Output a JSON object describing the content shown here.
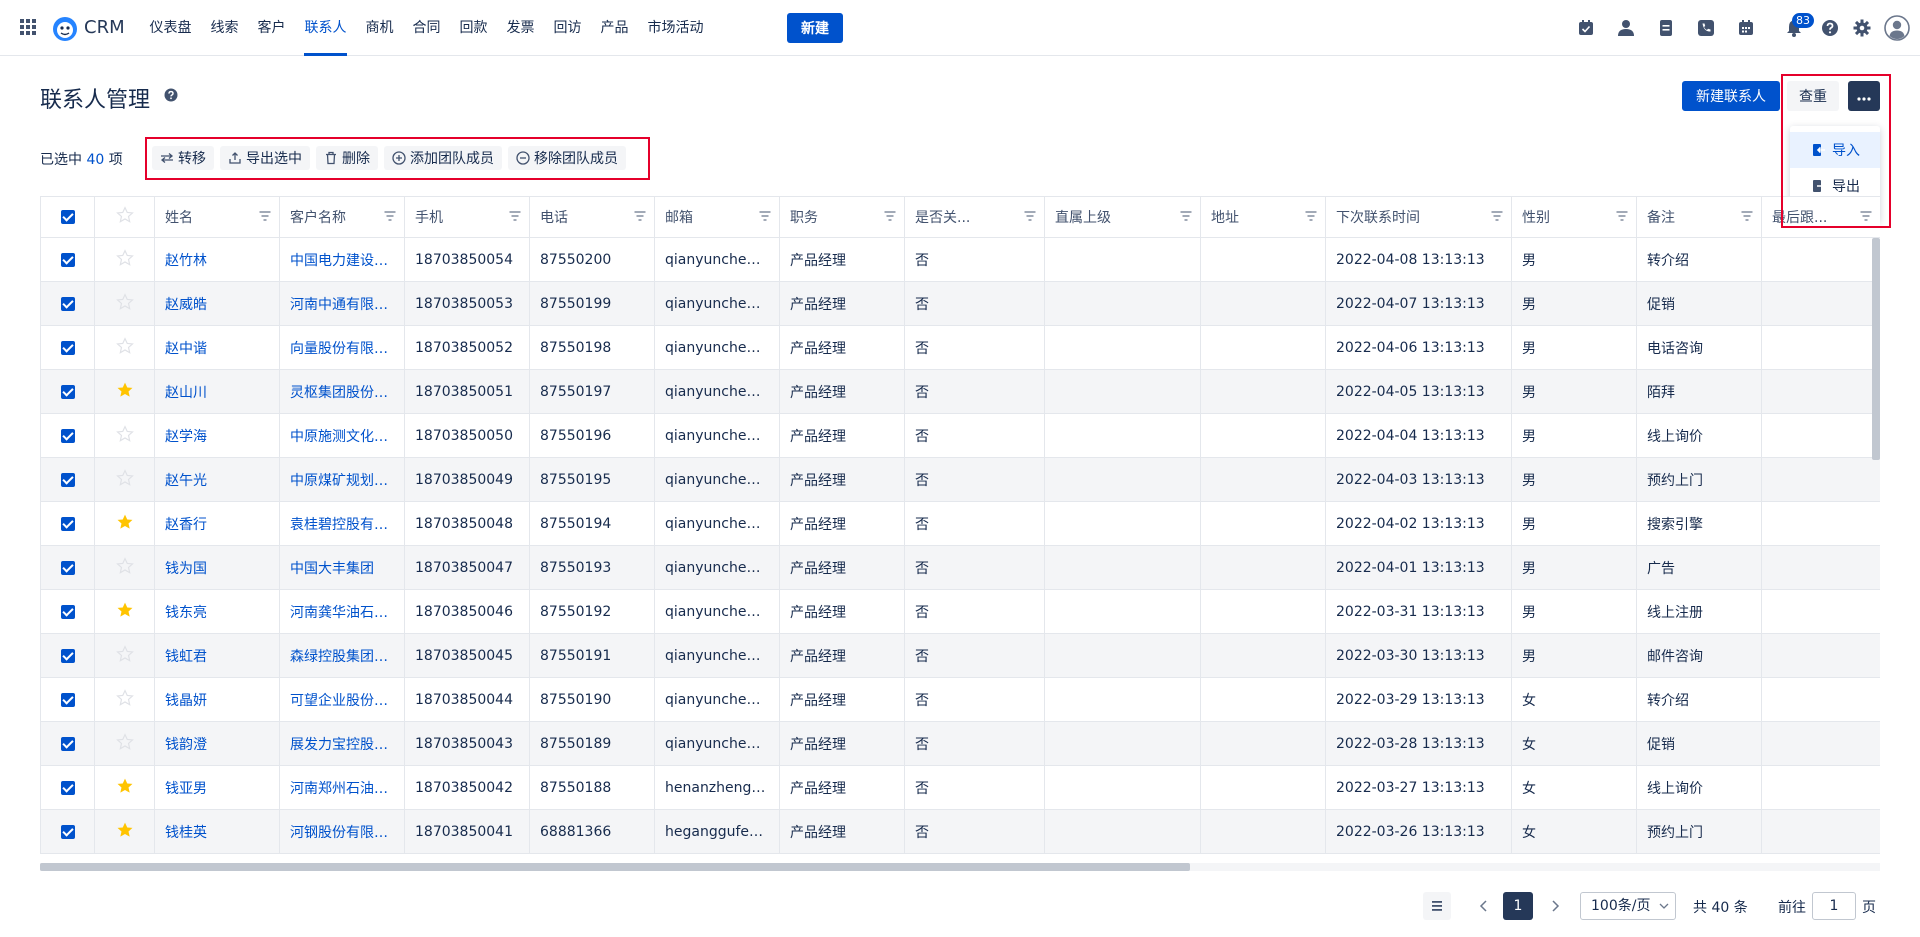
{
  "app": {
    "brand": "CRM"
  },
  "nav": {
    "items": [
      "仪表盘",
      "线索",
      "客户",
      "联系人",
      "商机",
      "合同",
      "回款",
      "发票",
      "回访",
      "产品",
      "市场活动"
    ],
    "active_index": 3,
    "new_label": "新建",
    "notification_count": "83"
  },
  "header": {
    "title": "联系人管理",
    "new_contact": "新建联系人",
    "reset": "查重",
    "more_menu": {
      "import": "导入",
      "export": "导出"
    }
  },
  "selection": {
    "prefix": "已选中",
    "count": "40",
    "suffix": "项"
  },
  "actions": {
    "transfer": "转移",
    "export_selected": "导出选中",
    "delete": "删除",
    "add_team_member": "添加团队成员",
    "remove_team_member": "移除团队成员"
  },
  "table": {
    "columns": [
      "姓名",
      "客户名称",
      "手机",
      "电话",
      "邮箱",
      "职务",
      "是否关...",
      "直属上级",
      "地址",
      "下次联系时间",
      "性别",
      "备注",
      "最后跟..."
    ],
    "rows": [
      {
        "starred": false,
        "name": "赵竹林",
        "customer": "中国电力建设股份...",
        "mobile": "18703850054",
        "phone": "87550200",
        "email": "qianyuncheng...",
        "title": "产品经理",
        "is_key": "否",
        "superior": "",
        "address": "",
        "next_contact": "2022-04-08 13:13:13",
        "gender": "男",
        "note": "转介绍"
      },
      {
        "starred": false,
        "name": "赵威皓",
        "customer": "河南中通有限公司",
        "mobile": "18703850053",
        "phone": "87550199",
        "email": "qianyuncheng...",
        "title": "产品经理",
        "is_key": "否",
        "superior": "",
        "address": "",
        "next_contact": "2022-04-07 13:13:13",
        "gender": "男",
        "note": "促销"
      },
      {
        "starred": false,
        "name": "赵中谐",
        "customer": "向量股份有限公司",
        "mobile": "18703850052",
        "phone": "87550198",
        "email": "qianyuncheng...",
        "title": "产品经理",
        "is_key": "否",
        "superior": "",
        "address": "",
        "next_contact": "2022-04-06 13:13:13",
        "gender": "男",
        "note": "电话咨询"
      },
      {
        "starred": true,
        "name": "赵山川",
        "customer": "灵枢集团股份有限...",
        "mobile": "18703850051",
        "phone": "87550197",
        "email": "qianyuncheng...",
        "title": "产品经理",
        "is_key": "否",
        "superior": "",
        "address": "",
        "next_contact": "2022-04-05 13:13:13",
        "gender": "男",
        "note": "陌拜"
      },
      {
        "starred": false,
        "name": "赵学海",
        "customer": "中原施测文化传媒...",
        "mobile": "18703850050",
        "phone": "87550196",
        "email": "qianyuncheng...",
        "title": "产品经理",
        "is_key": "否",
        "superior": "",
        "address": "",
        "next_contact": "2022-04-04 13:13:13",
        "gender": "男",
        "note": "线上询价"
      },
      {
        "starred": false,
        "name": "赵午光",
        "customer": "中原煤矿规划股份...",
        "mobile": "18703850049",
        "phone": "87550195",
        "email": "qianyuncheng...",
        "title": "产品经理",
        "is_key": "否",
        "superior": "",
        "address": "",
        "next_contact": "2022-04-03 13:13:13",
        "gender": "男",
        "note": "预约上门"
      },
      {
        "starred": true,
        "name": "赵香行",
        "customer": "袁桂碧控股有限公司",
        "mobile": "18703850048",
        "phone": "87550194",
        "email": "qianyuncheng...",
        "title": "产品经理",
        "is_key": "否",
        "superior": "",
        "address": "",
        "next_contact": "2022-04-02 13:13:13",
        "gender": "男",
        "note": "搜索引擎"
      },
      {
        "starred": false,
        "name": "钱为国",
        "customer": "中国大丰集团",
        "mobile": "18703850047",
        "phone": "87550193",
        "email": "qianyuncheng...",
        "title": "产品经理",
        "is_key": "否",
        "superior": "",
        "address": "",
        "next_contact": "2022-04-01 13:13:13",
        "gender": "男",
        "note": "广告"
      },
      {
        "starred": true,
        "name": "钱东亮",
        "customer": "河南龚华油石集团...",
        "mobile": "18703850046",
        "phone": "87550192",
        "email": "qianyuncheng...",
        "title": "产品经理",
        "is_key": "否",
        "superior": "",
        "address": "",
        "next_contact": "2022-03-31 13:13:13",
        "gender": "男",
        "note": "线上注册"
      },
      {
        "starred": false,
        "name": "钱虹君",
        "customer": "森绿控股集团股份...",
        "mobile": "18703850045",
        "phone": "87550191",
        "email": "qianyuncheng...",
        "title": "产品经理",
        "is_key": "否",
        "superior": "",
        "address": "",
        "next_contact": "2022-03-30 13:13:13",
        "gender": "男",
        "note": "邮件咨询"
      },
      {
        "starred": false,
        "name": "钱晶妍",
        "customer": "可望企业股份有限...",
        "mobile": "18703850044",
        "phone": "87550190",
        "email": "qianyuncheng...",
        "title": "产品经理",
        "is_key": "否",
        "superior": "",
        "address": "",
        "next_contact": "2022-03-29 13:13:13",
        "gender": "女",
        "note": "转介绍"
      },
      {
        "starred": false,
        "name": "钱韵澄",
        "customer": "展发力宝控股集团...",
        "mobile": "18703850043",
        "phone": "87550189",
        "email": "qianyuncheng...",
        "title": "产品经理",
        "is_key": "否",
        "superior": "",
        "address": "",
        "next_contact": "2022-03-28 13:13:13",
        "gender": "女",
        "note": "促销"
      },
      {
        "starred": true,
        "name": "钱亚男",
        "customer": "河南郑州石油集团...",
        "mobile": "18703850042",
        "phone": "87550188",
        "email": "henanzhengzh...",
        "title": "产品经理",
        "is_key": "否",
        "superior": "",
        "address": "",
        "next_contact": "2022-03-27 13:13:13",
        "gender": "女",
        "note": "线上询价"
      },
      {
        "starred": true,
        "name": "钱桂英",
        "customer": "河钢股份有限公司",
        "mobile": "18703850041",
        "phone": "68881366",
        "email": "heganggufen...",
        "title": "产品经理",
        "is_key": "否",
        "superior": "",
        "address": "",
        "next_contact": "2022-03-26 13:13:13",
        "gender": "女",
        "note": "预约上门"
      }
    ]
  },
  "pagination": {
    "current_page": "1",
    "page_size": "100条/页",
    "total": "共 40 条",
    "goto_prefix": "前往",
    "goto_value": "1",
    "goto_suffix": "页"
  },
  "colors": {
    "primary": "#0052cc",
    "dark": "#253858",
    "star": "#ffc400",
    "highlight": "#e5002b"
  }
}
